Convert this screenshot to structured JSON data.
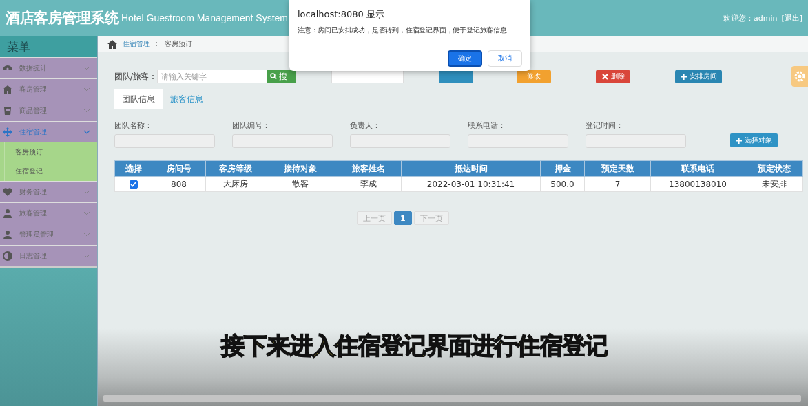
{
  "header": {
    "title": "酒店客房管理系统",
    "subtitle": "Hotel Guestroom Management System",
    "welcome": "欢迎您：admin",
    "logout": "[退出]"
  },
  "sidebar": {
    "title": "菜单",
    "items": [
      {
        "label": "数据统计",
        "selected": false,
        "expanded": false
      },
      {
        "label": "客房管理",
        "selected": false,
        "expanded": false
      },
      {
        "label": "商品管理",
        "selected": false,
        "expanded": false
      },
      {
        "label": "住宿管理",
        "selected": true,
        "expanded": true,
        "children": [
          {
            "label": "客房预订",
            "selected": false
          },
          {
            "label": "住宿登记",
            "selected": false
          }
        ]
      },
      {
        "label": "财务管理",
        "selected": false,
        "expanded": false
      },
      {
        "label": "旅客管理",
        "selected": false,
        "expanded": false
      },
      {
        "label": "管理员管理",
        "selected": false,
        "expanded": false
      },
      {
        "label": "日志管理",
        "selected": false,
        "expanded": false
      }
    ]
  },
  "breadcrumb": [
    "住宿管理",
    "客房预订"
  ],
  "toolbar": {
    "label": "团队/旅客：",
    "placeholder": "请输入关键字",
    "search": "搜",
    "buttons": [
      {
        "kind": "plain",
        "color": "#2f8fbd"
      },
      {
        "kind": "plain",
        "label": "修改",
        "color": "#f2a12f"
      },
      {
        "kind": "delete",
        "label": "删除",
        "color": "#d9463a"
      },
      {
        "kind": "add",
        "label": "安排房间",
        "color": "#2a86b2"
      }
    ]
  },
  "tabs": [
    {
      "label": "团队信息",
      "selected": true
    },
    {
      "label": "旅客信息",
      "selected": false
    }
  ],
  "form": {
    "fields": [
      {
        "label": "团队名称："
      },
      {
        "label": "团队编号："
      },
      {
        "label": "负责人："
      },
      {
        "label": "联系电话："
      },
      {
        "label": "登记时间："
      }
    ],
    "choose_button": "选择对象"
  },
  "table": {
    "columns": [
      "选择",
      "房间号",
      "客房等级",
      "接待对象",
      "旅客姓名",
      "抵达时间",
      "押金",
      "预定天数",
      "联系电话",
      "预定状态"
    ],
    "rows": [
      {
        "checked": true,
        "cells": [
          "",
          "808",
          "大床房",
          "散客",
          "李成",
          "2022-03-01 10:31:41",
          "500.0",
          "7",
          "13800138010",
          "未安排"
        ]
      }
    ]
  },
  "pagination": {
    "prev": "上一页",
    "next": "下一页",
    "prev_disabled": true,
    "next_disabled": true,
    "pages": [
      {
        "label": "1",
        "selected": true
      }
    ]
  },
  "dialog": {
    "title": "localhost:8080 显示",
    "message": "注意：房间已安排成功，是否转到，住宿登记界面，便于登记旅客信息",
    "ok": "确定",
    "cancel": "取消"
  },
  "caption": "接下来进入住宿登记界面进行住宿登记"
}
